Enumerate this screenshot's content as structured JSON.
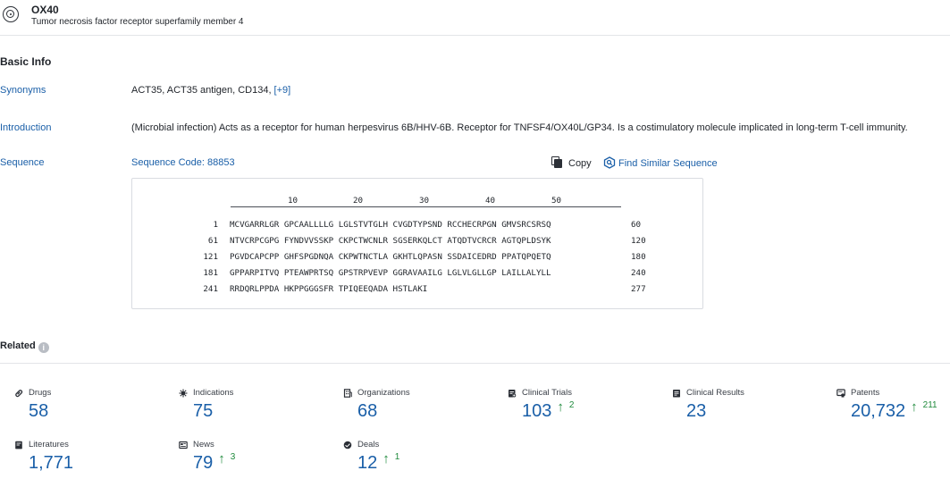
{
  "header": {
    "title": "OX40",
    "subtitle": "Tumor necrosis factor receptor superfamily member 4"
  },
  "basic_info": {
    "title": "Basic Info",
    "synonyms_label": "Synonyms",
    "synonyms_value": "ACT35,  ACT35 antigen,  CD134,",
    "synonyms_more": "[+9]",
    "introduction_label": "Introduction",
    "introduction_value": "(Microbial infection) Acts as a receptor for human herpesvirus 6B/HHV-6B. Receptor for TNFSF4/OX40L/GP34. Is a costimulatory molecule implicated in long-term T-cell immunity.",
    "sequence_label": "Sequence",
    "sequence_code": "Sequence Code: 88853",
    "copy_label": "Copy",
    "find_similar_label": "Find Similar Sequence"
  },
  "sequence": {
    "ruler": [
      "10",
      "20",
      "30",
      "40",
      "50"
    ],
    "rows": [
      {
        "start": "1",
        "residues": "MCVGARRLGR GPCAALLLLG LGLSTVTGLH CVGDTYPSND RCCHECRPGN GMVSRCSRSQ",
        "end": "60"
      },
      {
        "start": "61",
        "residues": "NTVCRPCGPG FYNDVVSSKP CKPCTWCNLR SGSERKQLCT ATQDTVCRCR AGTQPLDSYK",
        "end": "120"
      },
      {
        "start": "121",
        "residues": "PGVDCAPCPP GHFSPGDNQA CKPWTNCTLA GKHTLQPASN SSDAICEDRD PPATQPQETQ",
        "end": "180"
      },
      {
        "start": "181",
        "residues": "GPPARPITVQ PTEAWPRTSQ GPSTRPVEVP GGRAVAAILG LGLVLGLLGP LAILLALYLL",
        "end": "240"
      },
      {
        "start": "241",
        "residues": "RRDQRLPPDA HKPPGGGSFR TPIQEEQADA HSTLAKI",
        "end": "277"
      }
    ]
  },
  "related": {
    "title": "Related",
    "info_icon_glyph": "i",
    "stats": [
      {
        "label": "Drugs",
        "value": "58",
        "delta": "",
        "icon": "pill-icon"
      },
      {
        "label": "Indications",
        "value": "75",
        "delta": "",
        "icon": "virus-icon"
      },
      {
        "label": "Organizations",
        "value": "68",
        "delta": "",
        "icon": "building-icon"
      },
      {
        "label": "Clinical Trials",
        "value": "103",
        "delta": "2",
        "icon": "clipboard-icon"
      },
      {
        "label": "Clinical Results",
        "value": "23",
        "delta": "",
        "icon": "report-icon"
      },
      {
        "label": "Patents",
        "value": "20,732",
        "delta": "211",
        "icon": "patent-icon"
      },
      {
        "label": "Literatures",
        "value": "1,771",
        "delta": "",
        "icon": "document-icon"
      },
      {
        "label": "News",
        "value": "79",
        "delta": "3",
        "icon": "newspaper-icon"
      },
      {
        "label": "Deals",
        "value": "12",
        "delta": "1",
        "icon": "handshake-icon"
      }
    ],
    "delta_arrow": "↑"
  },
  "colors": {
    "link": "#1a5fa8",
    "increase": "#1f8a3c"
  }
}
